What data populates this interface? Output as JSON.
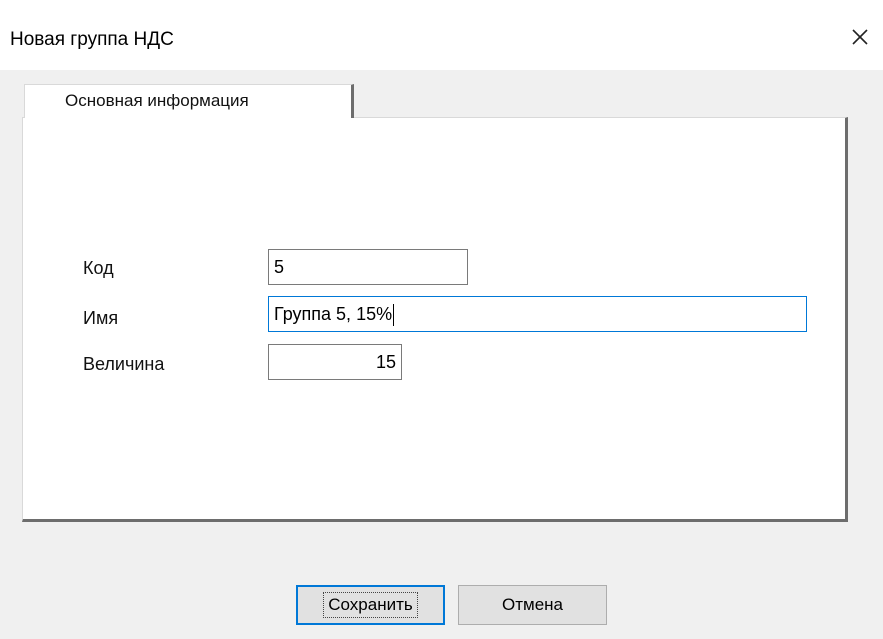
{
  "dialog": {
    "title": "Новая группа НДС",
    "close_icon": "close-icon"
  },
  "tabs": [
    {
      "label": "Основная информация",
      "selected": true
    }
  ],
  "form": {
    "code": {
      "label": "Код",
      "value": "5"
    },
    "name": {
      "label": "Имя",
      "value": "Группа 5, 15%"
    },
    "amount": {
      "label": "Величина",
      "value": "15"
    }
  },
  "buttons": {
    "save": "Сохранить",
    "cancel": "Отмена"
  },
  "colors": {
    "focus_accent": "#0078d7",
    "window_bg": "#f0f0f0",
    "panel_bg": "#ffffff"
  }
}
